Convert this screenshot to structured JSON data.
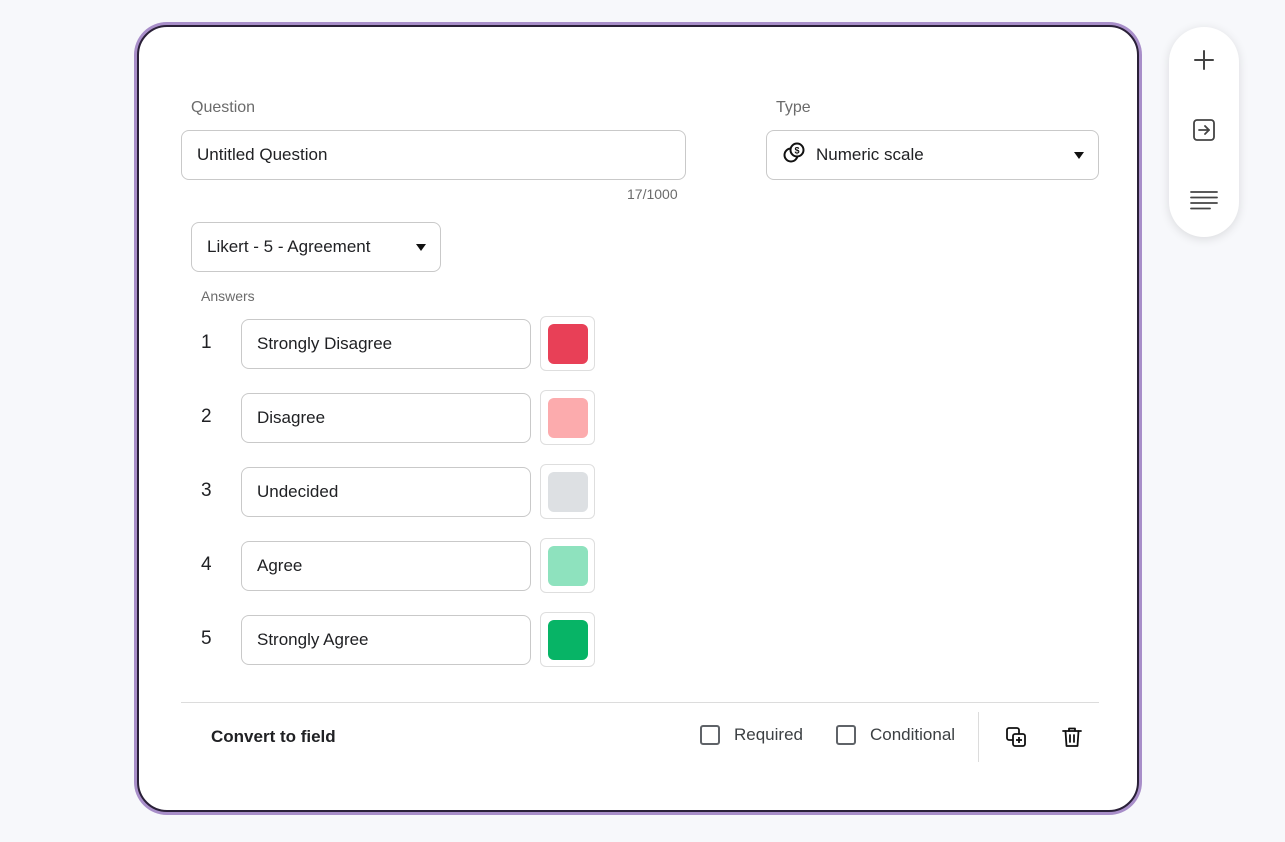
{
  "question": {
    "label": "Question",
    "value": "Untitled Question",
    "counter": "17/1000"
  },
  "type": {
    "label": "Type",
    "selected": "Numeric scale",
    "icon": "numeric-scale-icon"
  },
  "preset": {
    "selected": "Likert - 5 - Agreement"
  },
  "answers": {
    "label": "Answers",
    "items": [
      {
        "number": "1",
        "text": "Strongly Disagree",
        "color": "#E84057"
      },
      {
        "number": "2",
        "text": "Disagree",
        "color": "#FCABAD"
      },
      {
        "number": "3",
        "text": "Undecided",
        "color": "#DDE0E3"
      },
      {
        "number": "4",
        "text": "Agree",
        "color": "#8EE2BE"
      },
      {
        "number": "5",
        "text": "Strongly Agree",
        "color": "#07B466"
      }
    ]
  },
  "footer": {
    "convert_label": "Convert to field",
    "required_label": "Required",
    "conditional_label": "Conditional",
    "required_checked": false,
    "conditional_checked": false
  },
  "side_toolbar": {
    "items": [
      "plus-icon",
      "import-icon",
      "text-paragraph-icon"
    ]
  },
  "colors": {
    "card_border": "#2A2038",
    "card_glow": "#A88EC9",
    "background": "#F7F8FB"
  }
}
